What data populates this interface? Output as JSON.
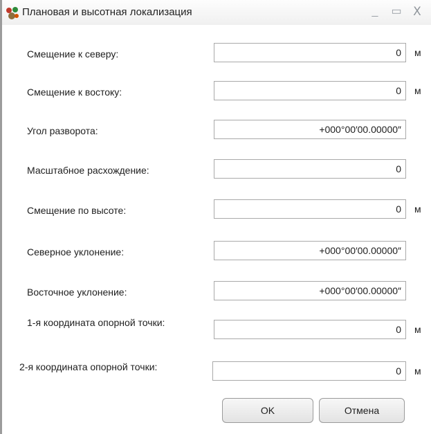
{
  "window": {
    "title": "Плановая и высотная локализация",
    "min_glyph": "_",
    "max_glyph": "▭",
    "close_glyph": "X"
  },
  "fields": [
    {
      "label": "Смещение к северу:",
      "value": "0",
      "unit": "м"
    },
    {
      "label": "Смещение к востоку:",
      "value": "0",
      "unit": "м"
    },
    {
      "label": "Угол разворота:",
      "value": "+000°00′00.00000″",
      "unit": ""
    },
    {
      "label": "Масштабное расхождение:",
      "value": "0",
      "unit": ""
    },
    {
      "label": "Смещение по высоте:",
      "value": "0",
      "unit": "м"
    },
    {
      "label": "Северное уклонение:",
      "value": "+000°00′00.00000″",
      "unit": ""
    },
    {
      "label": "Восточное уклонение:",
      "value": "+000°00′00.00000″",
      "unit": ""
    },
    {
      "label": "1-я координата опорной точки:",
      "value": "0",
      "unit": "м"
    },
    {
      "label": "2-я координата опорной точки:",
      "value": "0",
      "unit": "м"
    }
  ],
  "buttons": {
    "ok": "OK",
    "cancel": "Отмена"
  },
  "colors": {
    "field_border": "#a9a9a9",
    "button_border": "#9a9a9a",
    "window_border": "#9c9c9c"
  }
}
